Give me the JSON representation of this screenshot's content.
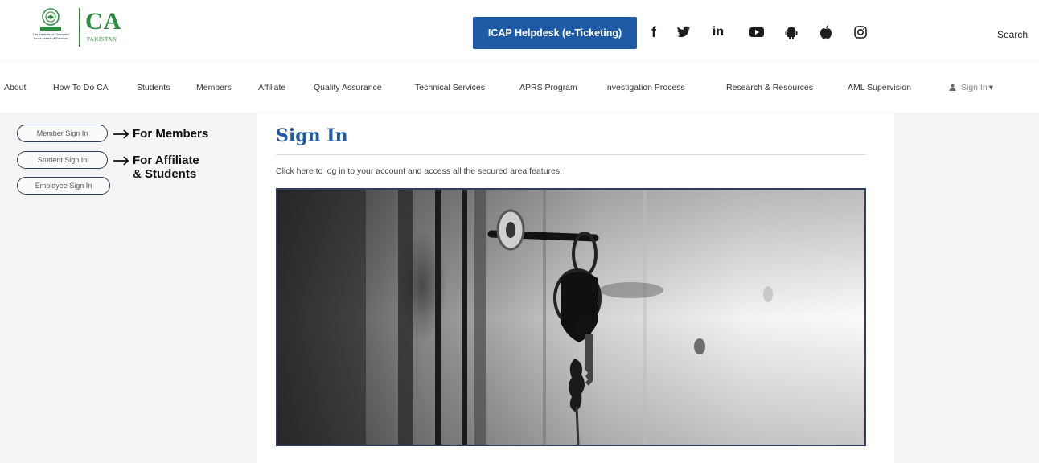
{
  "logo": {
    "mark": "CA",
    "sub": "PAKISTAN",
    "emblem_text": "The Institute of Chartered Accountants of Pakistan"
  },
  "header": {
    "helpdesk_label": "ICAP Helpdesk (e-Ticketing)",
    "social_icons": [
      "facebook-icon",
      "twitter-icon",
      "linkedin-icon",
      "youtube-icon",
      "android-icon",
      "apple-icon",
      "instagram-icon"
    ],
    "social_glyphs": {
      "facebook": "f",
      "linkedin": "in"
    },
    "search_label": "Search"
  },
  "nav": {
    "items": [
      "About",
      "How To Do CA",
      "Students",
      "Members",
      "Affiliate",
      "Quality Assurance",
      "Technical Services",
      "APRS Program",
      "Investigation Process",
      "Research & Resources",
      "AML Supervision"
    ],
    "signin_label": "Sign In",
    "signin_caret": "▾"
  },
  "sidebar": {
    "buttons": [
      "Member Sign In",
      "Student Sign In",
      "Employee Sign In"
    ],
    "annotations": {
      "members": "For Members",
      "affiliate_line1": "For Affiliate",
      "affiliate_line2": "& Students"
    }
  },
  "main": {
    "title": "Sign In",
    "intro": "Click here to log in to your account and access all the secured area features."
  },
  "colors": {
    "brand_green": "#2c8b3f",
    "brand_blue": "#1f5aa6",
    "border_navy": "#2f3f5c"
  }
}
